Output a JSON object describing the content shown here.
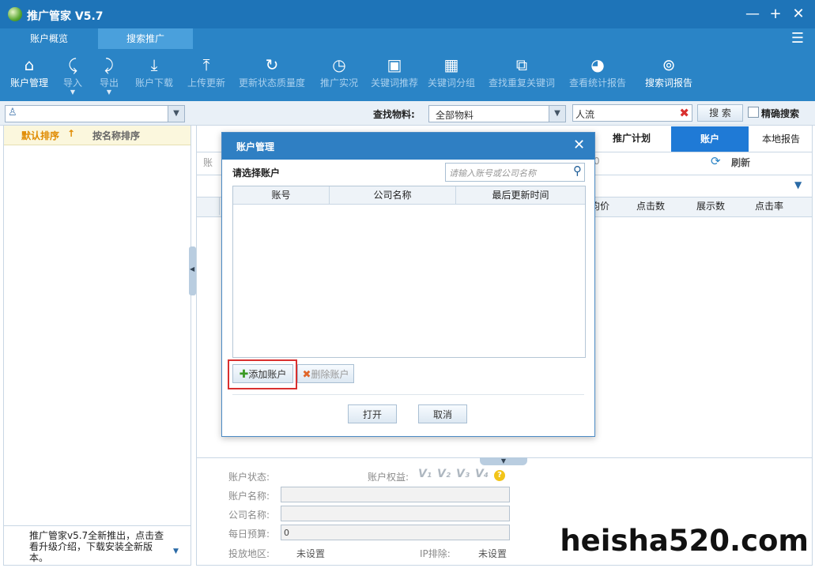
{
  "app": {
    "title": "推广管家 V5.7",
    "minimize": "—",
    "maximize": "+",
    "close": "✕"
  },
  "tabs": [
    "账户概览",
    "搜索推广"
  ],
  "toolbar": [
    {
      "label": "账户管理",
      "icon": "home-icon",
      "glyph": "⌂"
    },
    {
      "label": "导入",
      "icon": "import-icon",
      "glyph": "⤹"
    },
    {
      "label": "导出",
      "icon": "export-icon",
      "glyph": "⤸"
    },
    {
      "label": "账户下载",
      "icon": "download-icon",
      "glyph": "⤓"
    },
    {
      "label": "上传更新",
      "icon": "upload-icon",
      "glyph": "⤒"
    },
    {
      "label": "更新状态质量度",
      "icon": "refresh-icon",
      "glyph": "↻"
    },
    {
      "label": "推广实况",
      "icon": "clock-icon",
      "glyph": "◷"
    },
    {
      "label": "关键词推荐",
      "icon": "keyword-recommend-icon",
      "glyph": "▣"
    },
    {
      "label": "关键词分组",
      "icon": "grid-icon",
      "glyph": "▦"
    },
    {
      "label": "查找重复关键词",
      "icon": "find-duplicate-icon",
      "glyph": "⧉"
    },
    {
      "label": "查看统计报告",
      "icon": "pie-chart-icon",
      "glyph": "◕"
    },
    {
      "label": "搜索词报告",
      "icon": "search-report-icon",
      "glyph": "⊚"
    }
  ],
  "filter": {
    "search_label": "查找物料:",
    "material_value": "全部物料",
    "keyword_value": "人流",
    "search_button": "搜 索",
    "exact_search": "精确搜索"
  },
  "sort": {
    "default_sort": "默认排序",
    "default_arrow": "↑",
    "name_sort": "按名称排序"
  },
  "notice": "推广管家v5.7全新推出，点击查看升级介绍，下载安装全新版本。",
  "right_tabs": [
    "推广计划",
    "账户",
    "本地报告"
  ],
  "refresh_label": "刷新",
  "table_headers": [
    "均价",
    "点击数",
    "展示数",
    "点击率"
  ],
  "partial": {
    "left_char": "账",
    "right_char": "0"
  },
  "detail": {
    "status_label": "账户状态:",
    "rights_label": "账户权益:",
    "rights_levels": [
      "V₁",
      "V₂",
      "V₃",
      "V₄"
    ],
    "help_glyph": "?",
    "name_label": "账户名称:",
    "company_label": "公司名称:",
    "budget_label": "每日预算:",
    "budget_value": "0",
    "region_label": "投放地区:",
    "region_value": "未设置",
    "ip_label": "IP排除:",
    "ip_value": "未设置"
  },
  "modal": {
    "title": "账户管理",
    "close": "✕",
    "subtitle": "请选择账户",
    "search_placeholder": "请输入账号或公司名称",
    "columns": [
      "账号",
      "公司名称",
      "最后更新时间"
    ],
    "add_button": "添加账户",
    "delete_button": "删除账户",
    "open_button": "打开",
    "cancel_button": "取消"
  },
  "watermark": "heisha520.com",
  "colors": {
    "titlebar": "#1e74b8",
    "toolbar": "#2a84c6",
    "highlight": "#d9302f",
    "active_tab": "#1f7ad6"
  }
}
